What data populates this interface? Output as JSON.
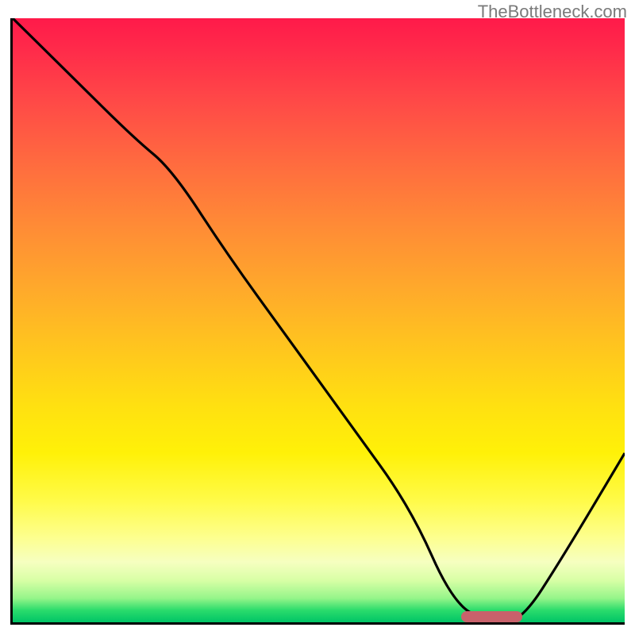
{
  "watermark": "TheBottleneck.com",
  "colors": {
    "frame": "#000000",
    "curve": "#000000",
    "marker": "#c9616b"
  },
  "chart_data": {
    "type": "line",
    "title": "",
    "xlabel": "",
    "ylabel": "",
    "xlim": [
      0,
      100
    ],
    "ylim": [
      0,
      100
    ],
    "grid": false,
    "curve_description": "Piecewise curve: steep descent from top-left, shallower through ~x=26, then near-linear drop to a flat minimum around x≈73–83 at y≈0, then sharp rise to ~y≈28 at x=100.",
    "x": [
      0,
      10,
      20,
      26,
      35,
      45,
      55,
      65,
      72,
      78,
      83,
      90,
      100
    ],
    "y": [
      100,
      90,
      80,
      75,
      61,
      47,
      33,
      19,
      3,
      0,
      0,
      11,
      28
    ],
    "marker": {
      "x_start": 73,
      "x_end": 83,
      "y": 0,
      "label": ""
    }
  }
}
